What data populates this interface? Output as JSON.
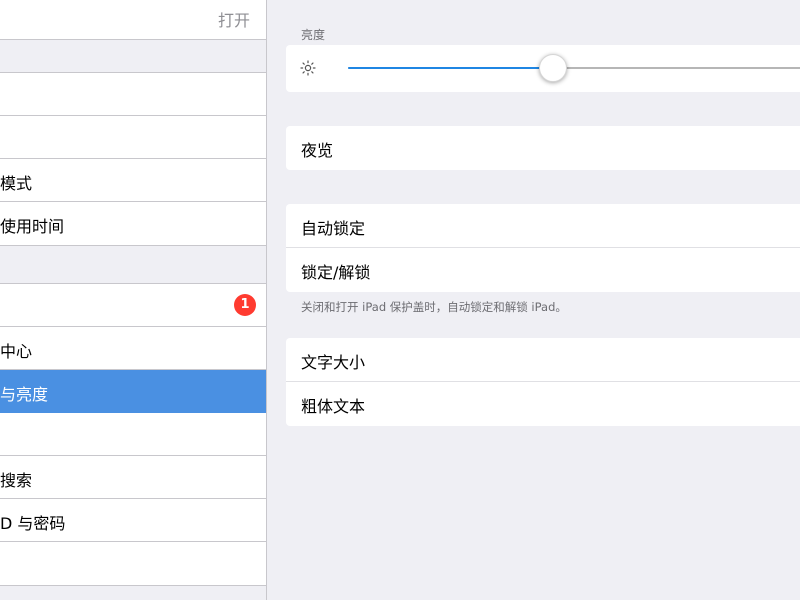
{
  "sidebar": {
    "top_value": "打开",
    "items": [
      {
        "label": ""
      },
      {
        "label": ""
      },
      {
        "label": "模式"
      },
      {
        "label": "使用时间"
      },
      {
        "label": "",
        "badge": "1"
      },
      {
        "label": "中心"
      },
      {
        "label": "与亮度",
        "selected": true
      },
      {
        "label": ""
      },
      {
        "label": "搜索"
      },
      {
        "label": "D 与密码"
      },
      {
        "label": ""
      }
    ]
  },
  "main": {
    "brightness": {
      "header": "亮度",
      "value": 0.437
    },
    "night_shift": "夜览",
    "auto_lock": "自动锁定",
    "lock_unlock": "锁定/解锁",
    "lock_note": "关闭和打开 iPad 保护盖时，自动锁定和解锁 iPad。",
    "text_size": "文字大小",
    "bold_text": "粗体文本"
  },
  "colors": {
    "selection": "#4a90e2",
    "slider_fill": "#1f86e3",
    "badge": "#ff3b30",
    "background": "#efeff4"
  },
  "icons": {
    "brightness": "sun-icon"
  }
}
